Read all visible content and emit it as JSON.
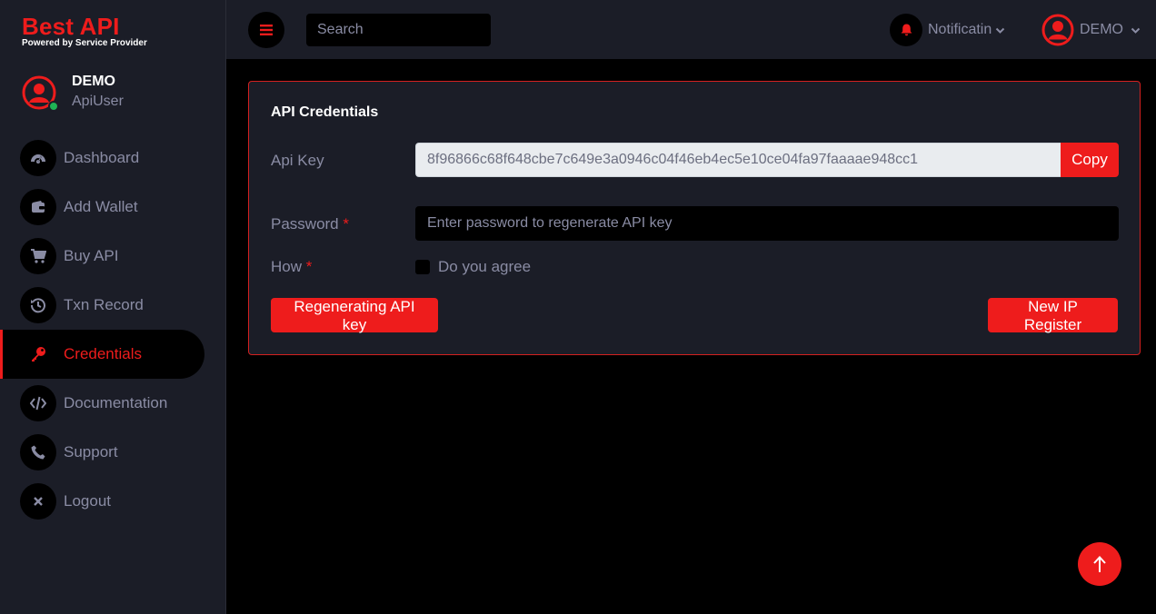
{
  "brand": {
    "title": "Best API",
    "subtitle": "Powered by Service Provider"
  },
  "profile": {
    "name": "DEMO",
    "role": "ApiUser",
    "status": "online"
  },
  "sidebar": {
    "items": [
      {
        "label": "Dashboard",
        "icon": "dashboard-icon"
      },
      {
        "label": "Add Wallet",
        "icon": "wallet-icon"
      },
      {
        "label": "Buy API",
        "icon": "cart-icon"
      },
      {
        "label": "Txn Record",
        "icon": "history-icon"
      },
      {
        "label": "Credentials",
        "icon": "key-icon",
        "active": true
      },
      {
        "label": "Documentation",
        "icon": "code-icon"
      },
      {
        "label": "Support",
        "icon": "phone-icon"
      },
      {
        "label": "Logout",
        "icon": "close-icon"
      }
    ]
  },
  "header": {
    "search_placeholder": "Search",
    "notification_label": "Notificatin",
    "user_label": "DEMO"
  },
  "card": {
    "title": "API Credentials",
    "api_key_label": "Api Key",
    "api_key_value": "8f96866c68f648cbe7c649e3a0946c04f46eb4ec5e10ce04fa97faaaae948cc1",
    "copy_label": "Copy",
    "password_label": "Password",
    "password_placeholder": "Enter password to regenerate API key",
    "how_label": "How",
    "required_mark": "*",
    "agree_label": "Do you agree",
    "regen_button": "Regenerating API key",
    "new_ip_button": "New IP Register"
  },
  "colors": {
    "accent": "#ee1c1c",
    "sidebar_bg": "#1b1d27",
    "page_bg": "#000000",
    "muted_text": "#8a8ca4",
    "online": "#1fb355"
  }
}
